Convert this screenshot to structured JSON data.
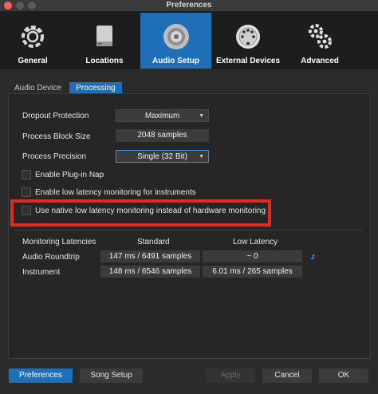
{
  "window": {
    "title": "Preferences"
  },
  "toolbar": {
    "items": [
      {
        "label": "General",
        "icon": "general-gear-icon"
      },
      {
        "label": "Locations",
        "icon": "drive-icon"
      },
      {
        "label": "Audio Setup",
        "icon": "speaker-icon",
        "active": true
      },
      {
        "label": "External Devices",
        "icon": "midi-connector-icon"
      },
      {
        "label": "Advanced",
        "icon": "gears-icon"
      }
    ]
  },
  "tabs": [
    {
      "label": "Audio Device"
    },
    {
      "label": "Processing",
      "active": true
    }
  ],
  "settings": {
    "dropout": {
      "label": "Dropout Protection",
      "value": "Maximum"
    },
    "block_size": {
      "label": "Process Block Size",
      "value": "2048 samples"
    },
    "precision": {
      "label": "Process Precision",
      "value": "Single (32 Bit)"
    }
  },
  "checkboxes": [
    {
      "label": "Enable Plug-in Nap",
      "checked": false
    },
    {
      "label": "Enable low latency monitoring for instruments",
      "checked": false
    },
    {
      "label": "Use native low latency monitoring instead of hardware monitoring",
      "checked": false
    }
  ],
  "latency": {
    "title": "Monitoring Latencies",
    "col_standard": "Standard",
    "col_low": "Low Latency",
    "rows": [
      {
        "label": "Audio Roundtrip",
        "standard": "147 ms / 6491 samples",
        "low": "~ 0"
      },
      {
        "label": "Instrument",
        "standard": "148 ms / 6546 samples",
        "low": "6.01 ms / 265 samples"
      }
    ],
    "z_label": "z"
  },
  "buttons": {
    "preferences": "Preferences",
    "song_setup": "Song Setup",
    "apply": "Apply",
    "cancel": "Cancel",
    "ok": "OK"
  },
  "colors": {
    "accent": "#1e6fb8",
    "highlight": "#e8281a"
  }
}
